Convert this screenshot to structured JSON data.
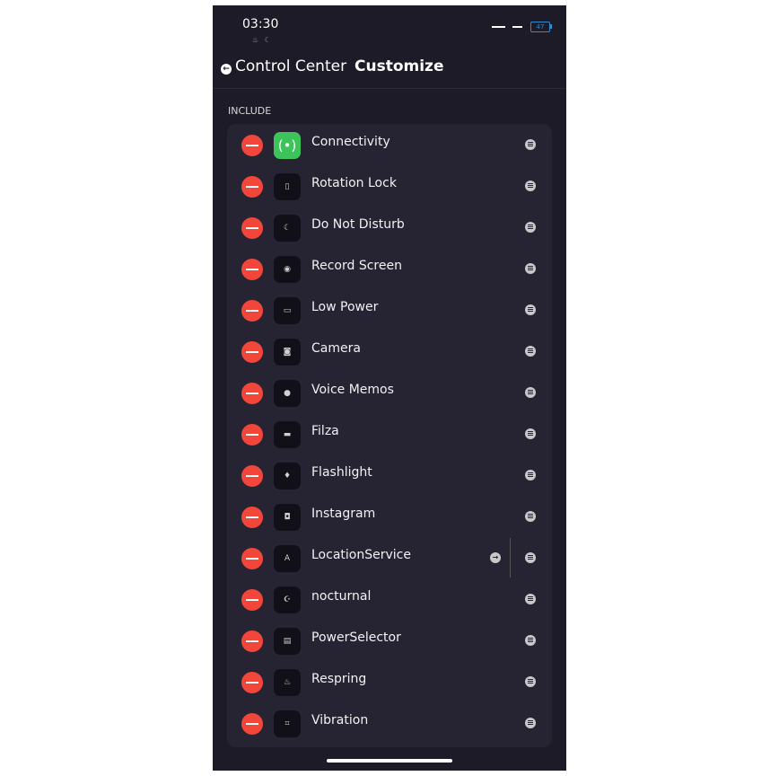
{
  "status": {
    "time": "03:30",
    "sub_icons": "♨ ☾",
    "battery": "47"
  },
  "nav": {
    "back_label": "Control Center",
    "title": "Customize"
  },
  "section": {
    "label": "INCLUDE"
  },
  "items": [
    {
      "label": "Connectivity",
      "icon": "(•)"
    },
    {
      "label": "Rotation Lock",
      "icon": "▯"
    },
    {
      "label": "Do Not Disturb",
      "icon": "☾"
    },
    {
      "label": "Record Screen",
      "icon": "◉"
    },
    {
      "label": "Low Power",
      "icon": "▭"
    },
    {
      "label": "Camera",
      "icon": "◙"
    },
    {
      "label": "Voice Memos",
      "icon": "●"
    },
    {
      "label": "Filza",
      "icon": "▬"
    },
    {
      "label": "Flashlight",
      "icon": "♦"
    },
    {
      "label": "Instagram",
      "icon": "◘"
    },
    {
      "label": "LocationService",
      "icon": "A"
    },
    {
      "label": "nocturnal",
      "icon": "☪"
    },
    {
      "label": "PowerSelector",
      "icon": "▤"
    },
    {
      "label": "Respring",
      "icon": "♨"
    },
    {
      "label": "Vibration",
      "icon": "⌗"
    }
  ]
}
